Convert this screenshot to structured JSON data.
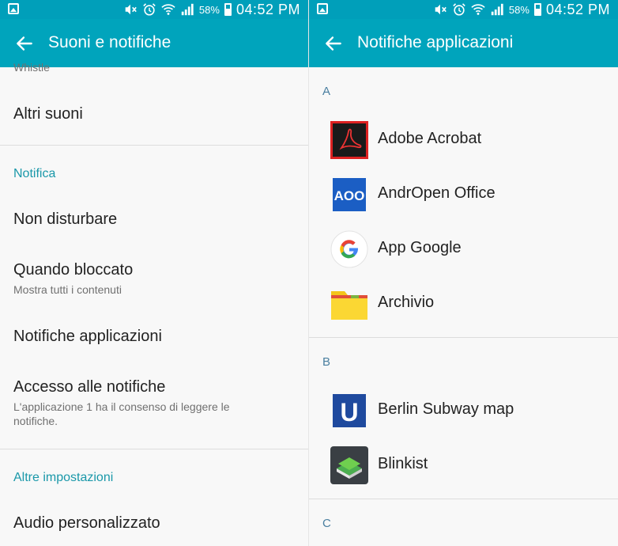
{
  "status_bar": {
    "battery_pct": "58%",
    "time": "04:52 PM"
  },
  "left": {
    "title": "Suoni e notifiche",
    "cutoff_text": "Whistle",
    "items": {
      "altri_suoni": "Altri suoni",
      "notifica_header": "Notifica",
      "non_disturbare": "Non disturbare",
      "quando_bloccato": "Quando bloccato",
      "quando_bloccato_sub": "Mostra tutti i contenuti",
      "notifiche_applicazioni": "Notifiche applicazioni",
      "accesso_notifiche": "Accesso alle notifiche",
      "accesso_notifiche_sub": "L'applicazione 1 ha il consenso di leggere le notifiche.",
      "altre_impostazioni_header": "Altre impostazioni",
      "audio_personalizzato": "Audio personalizzato"
    }
  },
  "right": {
    "title": "Notifiche applicazioni",
    "sections": [
      {
        "letter": "A",
        "apps": [
          {
            "label": "Adobe Acrobat",
            "icon": "adobe-acrobat-icon"
          },
          {
            "label": "AndrOpen Office",
            "icon": "andropen-office-icon",
            "icon_text": "AOO"
          },
          {
            "label": "App Google",
            "icon": "google-icon"
          },
          {
            "label": "Archivio",
            "icon": "folder-icon"
          }
        ]
      },
      {
        "letter": "B",
        "apps": [
          {
            "label": "Berlin Subway map",
            "icon": "u-bahn-icon",
            "icon_text": "U"
          },
          {
            "label": "Blinkist",
            "icon": "blinkist-icon"
          }
        ]
      },
      {
        "letter": "C",
        "apps": []
      }
    ]
  },
  "colors": {
    "status_bar": "#009fba",
    "app_bar": "#00a4bc",
    "section_header": "#1a98a9",
    "background": "#f8f8f8"
  }
}
